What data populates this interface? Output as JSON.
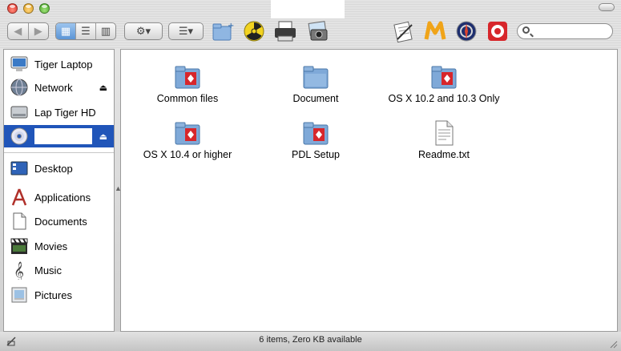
{
  "window": {
    "status_text": "6 items, Zero KB available"
  },
  "toolbar": {
    "nav": [
      {
        "name": "back",
        "glyph": "◀"
      },
      {
        "name": "forward",
        "glyph": "▶"
      }
    ],
    "view_icon_glyph": "▦",
    "view_list_glyph": "☰",
    "view_column_glyph": "▥",
    "action_glyph": "⚙▾",
    "arrange_glyph": "☰▾",
    "search_placeholder": ""
  },
  "sidebar": {
    "devices": [
      {
        "label": "Tiger Laptop",
        "icon": "computer-icon",
        "eject": false
      },
      {
        "label": "Network",
        "icon": "network-globe-icon",
        "eject": true
      },
      {
        "label": "Lap Tiger HD",
        "icon": "hard-drive-icon",
        "eject": false
      },
      {
        "label": "",
        "icon": "cd-disc-icon",
        "eject": true,
        "selected": true
      }
    ],
    "places": [
      {
        "label": "Desktop",
        "icon": "desktop-icon"
      },
      {
        "label": "Applications",
        "icon": "applications-icon"
      },
      {
        "label": "Documents",
        "icon": "documents-icon"
      },
      {
        "label": "Movies",
        "icon": "movies-icon"
      },
      {
        "label": "Music",
        "icon": "music-icon"
      },
      {
        "label": "Pictures",
        "icon": "pictures-icon"
      }
    ],
    "eject_glyph": "⏏"
  },
  "files": [
    {
      "label": "Common files",
      "icon": "folder-icon"
    },
    {
      "label": "Document",
      "icon": "plain-folder-icon"
    },
    {
      "label": "OS X 10.2 and 10.3 Only",
      "icon": "folder-icon"
    },
    {
      "label": "OS X 10.4 or higher",
      "icon": "folder-icon"
    },
    {
      "label": "PDL Setup",
      "icon": "folder-icon"
    },
    {
      "label": "Readme.txt",
      "icon": "text-file-icon"
    }
  ],
  "colors": {
    "selection": "#2055b9",
    "folder_blue": "#7fa9d8",
    "badge_red": "#d7262b"
  }
}
